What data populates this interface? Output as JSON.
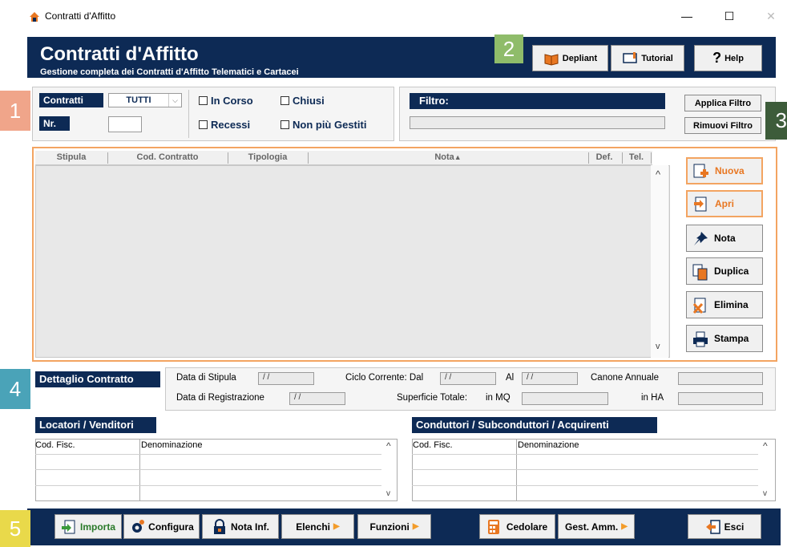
{
  "window": {
    "title": "Contratti d'Affitto",
    "min": "—",
    "max": "☐",
    "close": "✕"
  },
  "header": {
    "title": "Contratti d'Affitto",
    "subtitle": "Gestione completa dei Contratti d'Affitto Telematici e Cartacei",
    "buttons": {
      "depliant": "Depliant",
      "tutorial": "Tutorial",
      "help": "Help",
      "help_glyph": "?"
    }
  },
  "markers": [
    "1",
    "2",
    "3",
    "4",
    "5"
  ],
  "filters": {
    "contratti_label": "Contratti",
    "contratti_value": "TUTTI",
    "nr_label": "Nr.",
    "in_corso": "In Corso",
    "chiusi": "Chiusi",
    "recessi": "Recessi",
    "non_piu_gestiti": "Non più Gestiti",
    "filtro_label": "Filtro:",
    "applica": "Applica Filtro",
    "rimuovi": "Rimuovi Filtro"
  },
  "grid": {
    "columns": [
      "Stipula",
      "Cod. Contratto",
      "Tipologia",
      "Nota",
      "Def.",
      "Tel."
    ],
    "sort_glyph": "▲",
    "scroll_up": "^",
    "scroll_down": "v"
  },
  "side_buttons": {
    "nuova": "Nuova",
    "apri": "Apri",
    "nota": "Nota",
    "duplica": "Duplica",
    "elimina": "Elimina",
    "stampa": "Stampa"
  },
  "dettaglio": {
    "title": "Dettaglio Contratto",
    "data_stipula": "Data di Stipula",
    "data_registrazione": "Data di Registrazione",
    "ciclo_dal": "Ciclo Corrente: Dal",
    "al": "Al",
    "canone": "Canone Annuale",
    "superficie": "Superficie Totale:",
    "in_mq": "in MQ",
    "in_ha": "in HA",
    "date_placeholder": "/ /"
  },
  "locatori": {
    "title": "Locatori / Venditori",
    "cols": [
      "Cod. Fisc.",
      "Denominazione"
    ]
  },
  "conduttori": {
    "title": "Conduttori / Subconduttori / Acquirenti",
    "cols": [
      "Cod. Fisc.",
      "Denominazione"
    ]
  },
  "footer": {
    "importa": "Importa",
    "configura": "Configura",
    "nota_inf": "Nota Inf.",
    "elenchi": "Elenchi",
    "funzioni": "Funzioni",
    "cedolare": "Cedolare",
    "gest_amm": "Gest. Amm.",
    "esci": "Esci",
    "arrow": "▶"
  },
  "colors": {
    "navy": "#0d2a55",
    "orange": "#f3a461",
    "marker1": "#f0a58a",
    "marker2": "#8fbc6a",
    "marker3": "#3d5c3a",
    "marker4": "#4aa3b8",
    "marker5": "#e9d94a"
  }
}
